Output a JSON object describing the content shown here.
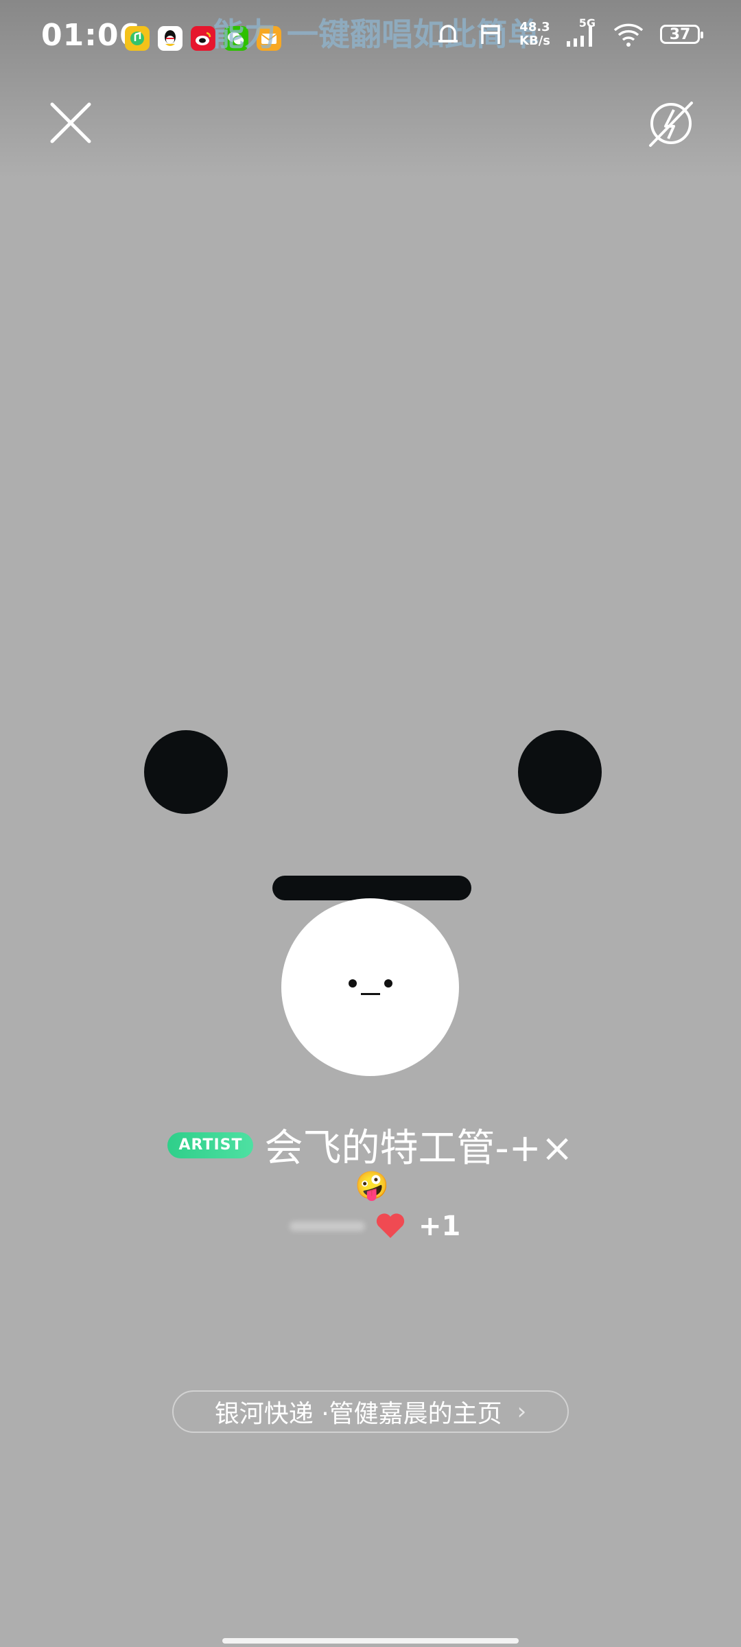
{
  "status_bar": {
    "time": "01:06",
    "marquee_text": "能力 一键翻唱如此简单",
    "network_speed_value": "48.3",
    "network_speed_unit": "KB/s",
    "network_type": "5G",
    "battery": "37",
    "app_icons": [
      "music-app-icon",
      "qq-icon",
      "weibo-icon",
      "wechat-icon",
      "mail-icon"
    ]
  },
  "profile": {
    "badge": "ARTIST",
    "username": "会飞的特工管-+×",
    "emoji": "🤪",
    "likes_extra": "+1",
    "homepage_link": "银河快递 ·管健嘉晨的主页"
  },
  "colors": {
    "background": "#aeaeae",
    "badge_green": "#2fcf8a",
    "heart": "#f04a52"
  }
}
